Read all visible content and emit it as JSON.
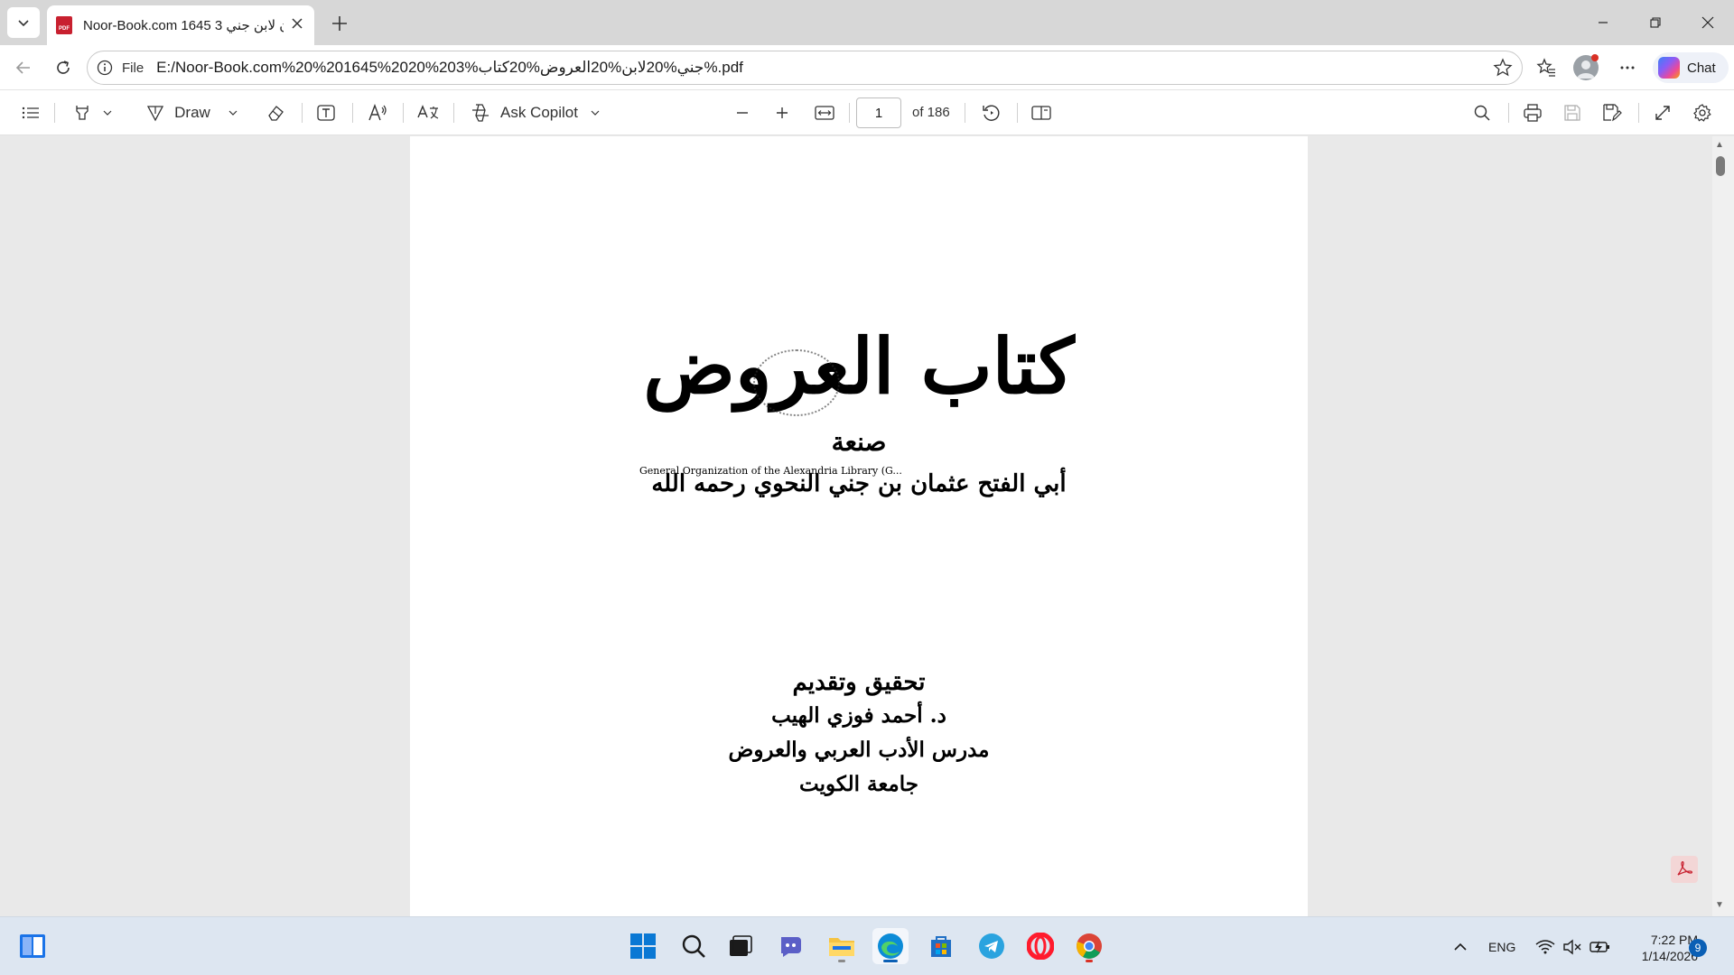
{
  "browser": {
    "tab": {
      "title": "Noor-Book.com 1645 3 ن لابن جني",
      "close_icon": "close-icon",
      "favicon_text": "PDF"
    },
    "address": {
      "file_label": "File",
      "url": "E:/Noor-Book.com%20%201645%2020%203%جني%20لابن%20العروض%20كتاب%.pdf"
    },
    "chat_label": "Chat"
  },
  "pdf_toolbar": {
    "draw_label": "Draw",
    "ask_copilot_label": "Ask Copilot",
    "page_number": "1",
    "page_total": "of 186"
  },
  "document": {
    "title": "كتاب العروض",
    "sana": "صنعة",
    "stamp_text": "General Organization of the Alexandria Library (G...",
    "author": "أبي الفتح عثمان بن جني النحوي رحمه الله",
    "tahqiq": "تحقيق وتقديم",
    "editor": "د. أحمد فوزي الهيب",
    "editor_title": "مدرس الأدب العربي والعروض",
    "university": "جامعة الكويت"
  },
  "taskbar": {
    "lang": "ENG",
    "time": "7:22 PM",
    "date": "1/14/2026",
    "notification_count": "9"
  },
  "colors": {
    "accent_blue": "#0a5fb5",
    "pdf_red": "#c8202f",
    "tab_bar": "#d7d7d7",
    "viewer_bg": "#e9e9e9",
    "taskbar_bg": "#dde6f1"
  }
}
